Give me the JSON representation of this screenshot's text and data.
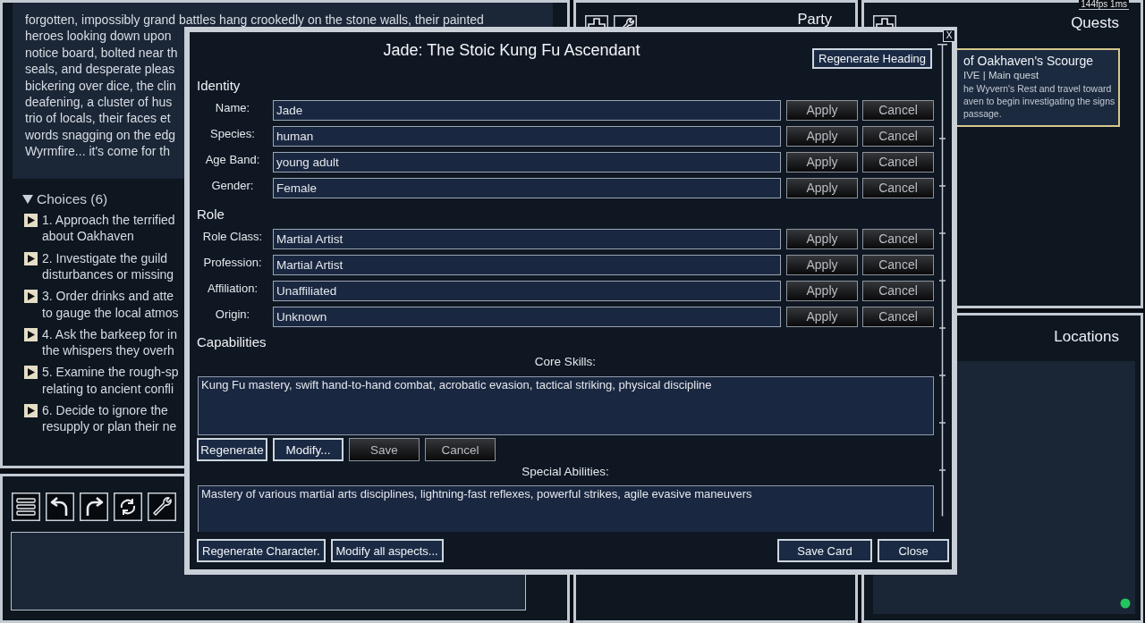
{
  "status": {
    "fps": "144fps 1ms"
  },
  "story": {
    "lines": [
      "forgotten, impossibly grand battles hang crookedly on the stone walls, their painted",
      "heroes looking down upon",
      "notice board, bolted near th",
      "seals, and desperate pleas",
      "bickering over dice, the clin",
      "deafening, a cluster of hus",
      "trio of locals, their faces et",
      "words snagging on the edg",
      "Wyrmfire... it's come for th"
    ],
    "choices_heading": "Choices (6)",
    "choices_expanded": true,
    "choices": [
      {
        "lines": [
          "1. Approach the terrified",
          "about Oakhaven"
        ]
      },
      {
        "lines": [
          "2. Investigate the guild",
          "disturbances or missing"
        ]
      },
      {
        "lines": [
          "3. Order drinks and atte",
          "to gauge the local atmos"
        ]
      },
      {
        "lines": [
          "4. Ask the barkeep for in",
          "the whispers they overh"
        ]
      },
      {
        "lines": [
          "5. Examine the rough-sp",
          "relating to ancient confli"
        ]
      },
      {
        "lines": [
          "6. Decide to ignore the",
          "resupply or plan their ne"
        ]
      }
    ]
  },
  "party": {
    "title": "Party"
  },
  "quests": {
    "title": "Quests",
    "items": [
      {
        "title": "of Oakhaven's Scourge",
        "meta": "IVE | Main quest",
        "objective": [
          "he Wyvern's Rest and travel toward",
          "aven to begin investigating the signs",
          "passage."
        ]
      }
    ]
  },
  "locations": {
    "title": "Locations"
  },
  "dialog": {
    "title": "Jade: The Stoic Kung Fu Ascendant",
    "close": "X",
    "heading_button": {
      "label": "Regenerate Heading",
      "disabled": false
    },
    "sections": [
      {
        "heading": "Identity",
        "fields": [
          {
            "label": "Name:",
            "value": "Jade",
            "buttons": [
              {
                "label": "Apply",
                "disabled": true
              },
              {
                "label": "Cancel",
                "disabled": true
              }
            ]
          },
          {
            "label": "Species:",
            "value": "human",
            "buttons": [
              {
                "label": "Apply",
                "disabled": true
              },
              {
                "label": "Cancel",
                "disabled": true
              }
            ]
          },
          {
            "label": "Age Band:",
            "value": "young adult",
            "buttons": [
              {
                "label": "Apply",
                "disabled": true
              },
              {
                "label": "Cancel",
                "disabled": true
              }
            ]
          },
          {
            "label": "Gender:",
            "value": "Female",
            "buttons": [
              {
                "label": "Apply",
                "disabled": true
              },
              {
                "label": "Cancel",
                "disabled": true
              }
            ]
          }
        ]
      },
      {
        "heading": "Role",
        "fields": [
          {
            "label": "Role Class:",
            "value": "Martial Artist",
            "buttons": [
              {
                "label": "Apply",
                "disabled": true
              },
              {
                "label": "Cancel",
                "disabled": true
              }
            ]
          },
          {
            "label": "Profession:",
            "value": "Martial Artist",
            "buttons": [
              {
                "label": "Apply",
                "disabled": true
              },
              {
                "label": "Cancel",
                "disabled": true
              }
            ]
          },
          {
            "label": "Affiliation:",
            "value": "Unaffiliated",
            "buttons": [
              {
                "label": "Apply",
                "disabled": true
              },
              {
                "label": "Cancel",
                "disabled": true
              }
            ]
          },
          {
            "label": "Origin:",
            "value": "Unknown",
            "buttons": [
              {
                "label": "Apply",
                "disabled": true
              },
              {
                "label": "Cancel",
                "disabled": true
              }
            ]
          }
        ]
      }
    ],
    "capabilities": {
      "heading": "Capabilities",
      "blocks": [
        {
          "label": "Core Skills:",
          "text": "Kung Fu mastery, swift hand-to-hand combat, acrobatic evasion, tactical striking, physical discipline",
          "buttons": [
            {
              "label": "Regenerate",
              "disabled": false
            },
            {
              "label": "Modify...",
              "disabled": false
            },
            {
              "label": "Save",
              "disabled": true
            },
            {
              "label": "Cancel",
              "disabled": true
            }
          ]
        },
        {
          "label": "Special Abilities:",
          "text": "Mastery of various martial arts disciplines, lightning-fast reflexes, powerful strikes, agile evasive maneuvers"
        }
      ]
    },
    "footer_left": [
      {
        "label": "Regenerate Character.",
        "disabled": false
      },
      {
        "label": "Modify all aspects...",
        "disabled": false
      }
    ],
    "footer_right": [
      {
        "label": "Save Card",
        "disabled": false
      },
      {
        "label": "Close",
        "disabled": false
      }
    ]
  }
}
